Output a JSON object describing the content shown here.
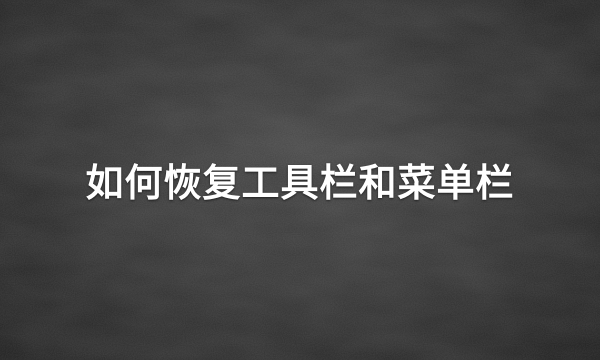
{
  "cover": {
    "title": "如何恢复工具栏和菜单栏",
    "background_color": "#2b2b2b",
    "text_color": "#ffffff",
    "style": "chalkboard"
  }
}
